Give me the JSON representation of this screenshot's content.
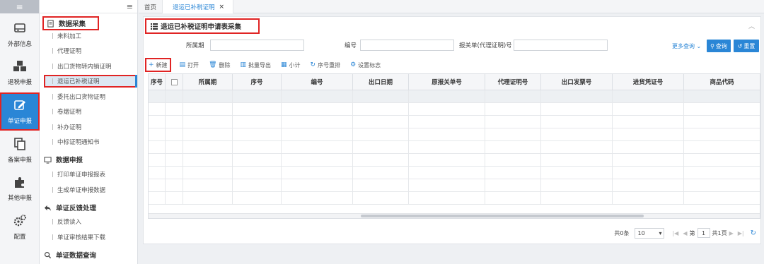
{
  "rail": {
    "items": [
      {
        "label": "外部信息",
        "icon": "external-info-icon"
      },
      {
        "label": "退税申报",
        "icon": "cubes-icon"
      },
      {
        "label": "单证申报",
        "icon": "edit-icon"
      },
      {
        "label": "备案申报",
        "icon": "copy-icon"
      },
      {
        "label": "其他申报",
        "icon": "puzzle-icon"
      },
      {
        "label": "配置",
        "icon": "gears-icon"
      }
    ]
  },
  "subnav": {
    "groups": [
      {
        "label": "数据采集",
        "items": [
          "来料加工",
          "代理证明",
          "出口货物转内销证明",
          "退运已补税证明",
          "委托出口货物证明",
          "卷烟证明",
          "补办证明",
          "中标证明通知书"
        ]
      },
      {
        "label": "数据申报",
        "items": [
          "打印单证申报报表",
          "生成单证申报数据"
        ]
      },
      {
        "label": "单证反馈处理",
        "items": [
          "反馈读入",
          "单证审核结果下载"
        ]
      },
      {
        "label": "单证数据查询",
        "items": []
      }
    ]
  },
  "tabs": [
    {
      "label": "首页"
    },
    {
      "label": "退运已补税证明",
      "close": "×"
    }
  ],
  "panel": {
    "title": "退运已补税证明申请表采集",
    "search": {
      "period_label": "所属期",
      "number_label": "编号",
      "customs_label": "报关单(代理证明)号",
      "more_query": "更多查询",
      "query_button": "查询",
      "reset_button": "重置"
    },
    "toolbar": {
      "new": "新建",
      "open": "打开",
      "delete": "删除",
      "batch_export": "批量导出",
      "subtotal": "小计",
      "renumber": "序号重排",
      "set_flag": "设置标志"
    },
    "grid": {
      "columns": [
        "序号",
        "",
        "所属期",
        "序号",
        "编号",
        "出口日期",
        "原报关单号",
        "代理证明号",
        "出口发票号",
        "进货凭证号",
        "商品代码"
      ]
    },
    "pager": {
      "total": "共0条",
      "page_size": "10",
      "page_prefix": "第",
      "page_value": "1",
      "page_total": "共1页"
    }
  },
  "colors": {
    "accent": "#2a86d6",
    "highlight_box": "#e02424"
  }
}
